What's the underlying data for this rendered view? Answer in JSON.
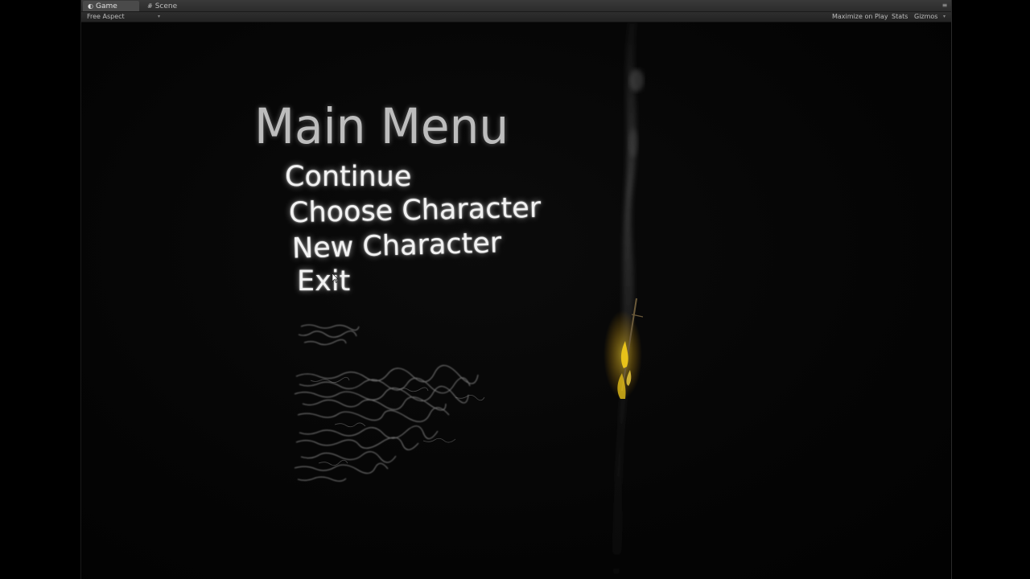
{
  "tabs": [
    {
      "label": "Game",
      "icon": "game-controller-icon",
      "active": true
    },
    {
      "label": "Scene",
      "icon": "grid-icon",
      "active": false
    }
  ],
  "toolbar": {
    "aspect": "Free Aspect",
    "maximize": "Maximize on Play",
    "stats": "Stats",
    "gizmos": "Gizmos"
  },
  "menu": {
    "title": "Main Menu",
    "items": [
      "Continue",
      "Choose Character",
      "New Character",
      "Exit"
    ]
  },
  "colors": {
    "title": "#bdbdbd",
    "items": "#f2f2f2",
    "torch_flame": "#e8c21a",
    "background": "#050505"
  }
}
